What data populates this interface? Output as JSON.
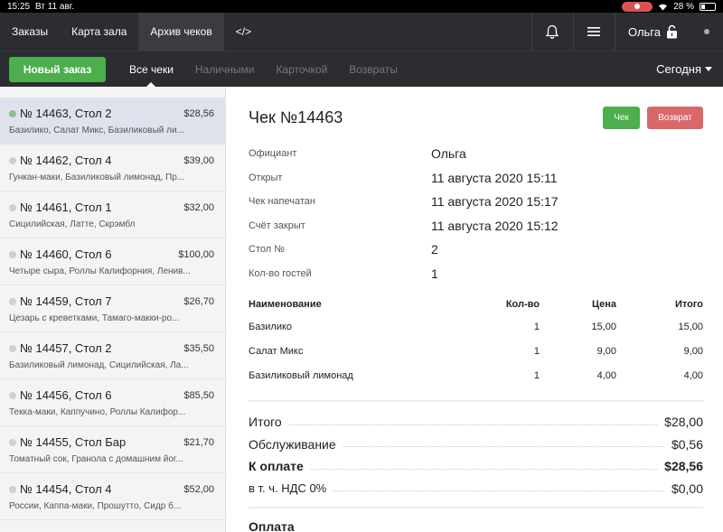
{
  "statusbar": {
    "time": "15:25",
    "date": "Вт 11 авг.",
    "battery": "28 %",
    "battery_level": 0.28
  },
  "topnav": {
    "tabs": [
      {
        "label": "Заказы",
        "active": false
      },
      {
        "label": "Карта зала",
        "active": false
      },
      {
        "label": "Архив чеков",
        "active": true
      },
      {
        "label": "</>",
        "active": false
      }
    ],
    "user": "Ольга",
    "icons": [
      "bell-icon",
      "menu-icon",
      "lock-icon"
    ]
  },
  "subnav": {
    "new_order": "Новый заказ",
    "filters": [
      {
        "label": "Все чеки",
        "active": true
      },
      {
        "label": "Наличными",
        "active": false
      },
      {
        "label": "Карточкой",
        "active": false
      },
      {
        "label": "Возвраты",
        "active": false
      }
    ],
    "period": "Сегодня",
    "accent": "#4cae4c"
  },
  "sidebar": {
    "items": [
      {
        "title": "№ 14463, Стол 2",
        "amount": "$28,56",
        "desc": "Базилико, Салат Микс, Базиликовый ли...",
        "active": true
      },
      {
        "title": "№ 14462, Стол 4",
        "amount": "$39,00",
        "desc": "Гункан-маки, Базиликовый лимонад, Пр...",
        "active": false
      },
      {
        "title": "№ 14461, Стол 1",
        "amount": "$32,00",
        "desc": "Сицилийская, Латте, Скрэмбл",
        "active": false
      },
      {
        "title": "№ 14460, Стол 6",
        "amount": "$100,00",
        "desc": "Четыре сыра, Роллы Калифорния, Ленив...",
        "active": false
      },
      {
        "title": "№ 14459, Стол 7",
        "amount": "$26,70",
        "desc": "Цезарь с креветками, Тамаго-макки-ро...",
        "active": false
      },
      {
        "title": "№ 14457, Стол 2",
        "amount": "$35,50",
        "desc": "Базиликовый лимонад, Сицилийская, Ла...",
        "active": false
      },
      {
        "title": "№ 14456, Стол 6",
        "amount": "$85,50",
        "desc": "Текка-маки, Каппучино, Роллы Калифор...",
        "active": false
      },
      {
        "title": "№ 14455, Стол Бар",
        "amount": "$21,70",
        "desc": "Томатный сок, Гранола с домашним йог...",
        "active": false
      },
      {
        "title": "№ 14454, Стол 4",
        "amount": "$52,00",
        "desc": "России, Каппа-маки, Прошутто, Сидр б...",
        "active": false
      }
    ]
  },
  "receipt": {
    "title": "Чек №14463",
    "btn_check": "Чек",
    "btn_return": "Возврат",
    "info": [
      {
        "k": "Официант",
        "v": "Ольга"
      },
      {
        "k": "Открыт",
        "v": "11 августа 2020 15:11"
      },
      {
        "k": "Чек напечатан",
        "v": "11 августа 2020 15:17"
      },
      {
        "k": "Счёт закрыт",
        "v": "11 августа 2020 15:12"
      },
      {
        "k": "Стол №",
        "v": "2"
      },
      {
        "k": "Кол-во гостей",
        "v": "1"
      }
    ],
    "columns": {
      "name": "Наименование",
      "qty": "Кол-во",
      "price": "Цена",
      "total": "Итого"
    },
    "lines": [
      {
        "name": "Базилико",
        "qty": "1",
        "price": "15,00",
        "total": "15,00"
      },
      {
        "name": "Салат Микс",
        "qty": "1",
        "price": "9,00",
        "total": "9,00"
      },
      {
        "name": "Базиликовый лимонад",
        "qty": "1",
        "price": "4,00",
        "total": "4,00"
      }
    ],
    "totals": [
      {
        "label": "Итого",
        "amount": "$28,00",
        "bold": false
      },
      {
        "label": "Обслуживание",
        "amount": "$0,56",
        "bold": false
      },
      {
        "label": "К оплате",
        "amount": "$28,56",
        "bold": true
      },
      {
        "label": "в т. ч. НДС 0%",
        "amount": "$0,00",
        "bold": false
      }
    ],
    "payment_heading": "Оплата"
  }
}
